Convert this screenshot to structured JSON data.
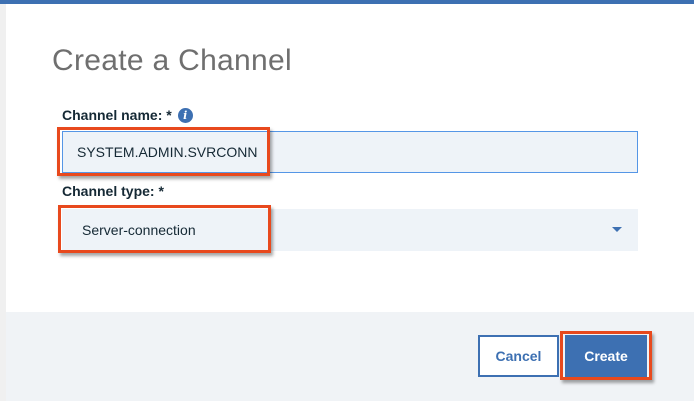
{
  "dialog": {
    "title": "Create a Channel"
  },
  "form": {
    "channel_name": {
      "label": "Channel name: *",
      "value": "SYSTEM.ADMIN.SVRCONN",
      "info_icon": "info-icon"
    },
    "channel_type": {
      "label": "Channel type: *",
      "selected": "Server-connection",
      "chevron_icon": "chevron-down-icon"
    }
  },
  "footer": {
    "cancel_label": "Cancel",
    "create_label": "Create"
  },
  "colors": {
    "accent": "#3d70b2",
    "highlight": "#e8491d",
    "field_background": "#eef3f8",
    "footer_background": "#f0f3f6"
  }
}
